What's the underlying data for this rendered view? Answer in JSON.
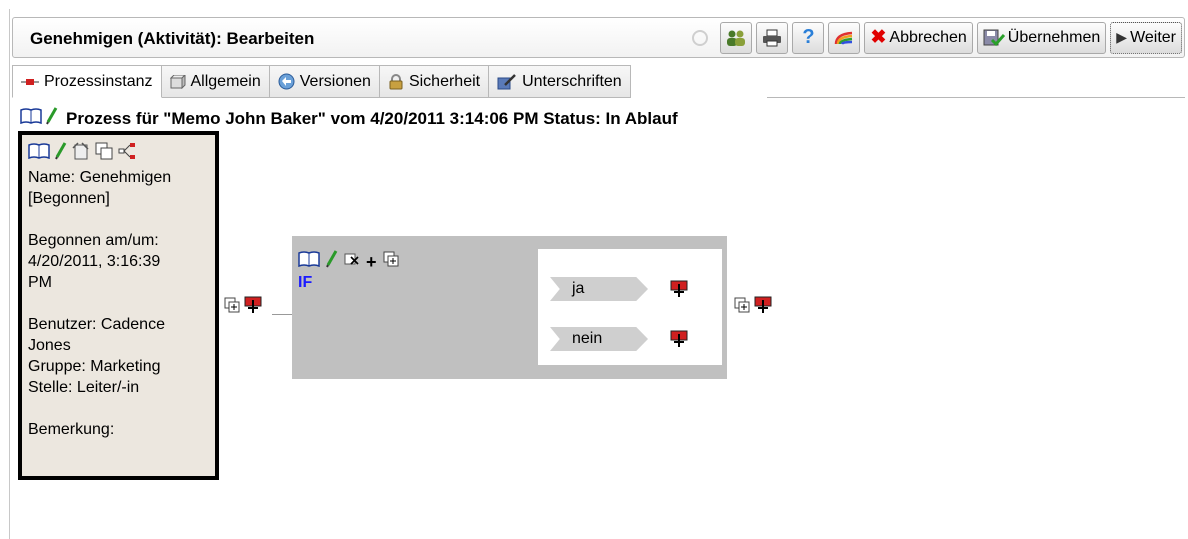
{
  "header": {
    "title": "Genehmigen (Aktivität): Bearbeiten",
    "buttons": {
      "cancel": "Abbrechen",
      "apply": "Übernehmen",
      "next": "Weiter"
    }
  },
  "tabs": [
    {
      "label": "Prozessinstanz"
    },
    {
      "label": "Allgemein"
    },
    {
      "label": "Versionen"
    },
    {
      "label": "Sicherheit"
    },
    {
      "label": "Unterschriften"
    }
  ],
  "process": {
    "title": "Prozess für \"Memo John Baker\" vom 4/20/2011 3:14:06 PM Status: In Ablauf"
  },
  "activity": {
    "name_line1": "Name: Genehmigen",
    "name_line2": "[Begonnen]",
    "started_line1": "Begonnen am/um:",
    "started_line2": "4/20/2011, 3:16:39",
    "started_line3": "PM",
    "user_line1": "Benutzer: Cadence",
    "user_line2": "Jones",
    "group": "Gruppe: Marketing",
    "position": "Stelle: Leiter/-in",
    "remark": "Bemerkung:"
  },
  "if_block": {
    "label": "IF",
    "branches": [
      {
        "label": "ja"
      },
      {
        "label": "nein"
      }
    ]
  },
  "colors": {
    "activity_bg": "#ece7df",
    "if_bg": "#c0c0c0",
    "if_label": "#1a1aff",
    "cancel_icon": "#e00000"
  }
}
